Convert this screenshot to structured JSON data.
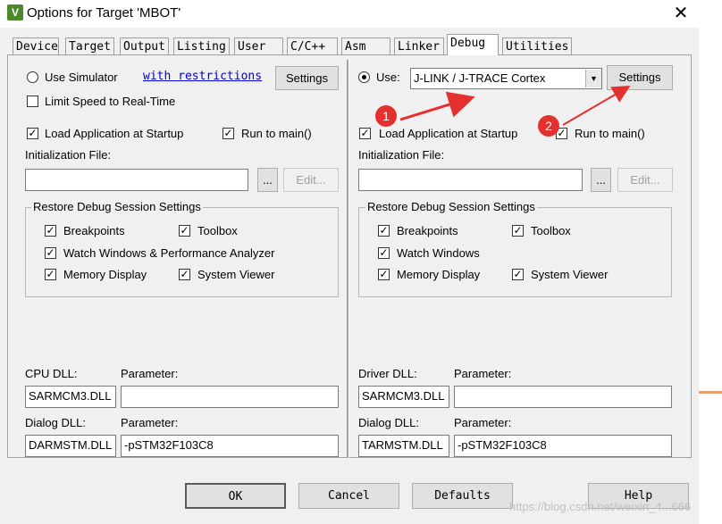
{
  "window": {
    "title": "Options for Target 'MBOT'",
    "app_icon_text": "V"
  },
  "tabs": [
    "Device",
    "Target",
    "Output",
    "Listing",
    "User",
    "C/C++",
    "Asm",
    "Linker",
    "Debug",
    "Utilities"
  ],
  "active_tab": "Debug",
  "left": {
    "use_simulator_label": "Use Simulator",
    "restrictions_link": "with restrictions",
    "settings_label": "Settings",
    "limit_speed_label": "Limit Speed to Real-Time",
    "load_app_label": "Load Application at Startup",
    "run_to_main_label": "Run to main()",
    "init_file_label": "Initialization File:",
    "browse_label": "...",
    "edit_label": "Edit...",
    "restore_group_label": "Restore Debug Session Settings",
    "breakpoints_label": "Breakpoints",
    "toolbox_label": "Toolbox",
    "watch_label": "Watch Windows & Performance Analyzer",
    "memory_label": "Memory Display",
    "sysviewer_label": "System Viewer",
    "cpu_dll_label": "CPU DLL:",
    "param_label": "Parameter:",
    "cpu_dll_value": "SARMCM3.DLL",
    "cpu_param_value": "",
    "dialog_dll_label": "Dialog DLL:",
    "dialog_dll_value": "DARMSTM.DLL",
    "dialog_param_value": "-pSTM32F103C8"
  },
  "right": {
    "use_label": "Use:",
    "debugger_value": "J-LINK / J-TRACE Cortex",
    "settings_label": "Settings",
    "load_app_label": "Load Application at Startup",
    "run_to_main_label": "Run to main()",
    "init_file_label": "Initialization File:",
    "browse_label": "...",
    "edit_label": "Edit...",
    "restore_group_label": "Restore Debug Session Settings",
    "breakpoints_label": "Breakpoints",
    "toolbox_label": "Toolbox",
    "watch_label": "Watch Windows",
    "memory_label": "Memory Display",
    "sysviewer_label": "System Viewer",
    "driver_dll_label": "Driver DLL:",
    "param_label": "Parameter:",
    "driver_dll_value": "SARMCM3.DLL",
    "driver_param_value": "",
    "dialog_dll_label": "Dialog DLL:",
    "dialog_dll_value": "TARMSTM.DLL",
    "dialog_param_value": "-pSTM32F103C8"
  },
  "annotations": {
    "badge1": "1",
    "badge2": "2",
    "color": "#e53030"
  },
  "footer": {
    "ok": "OK",
    "cancel": "Cancel",
    "defaults": "Defaults",
    "help": "Help"
  },
  "watermark": "https://blog.csdn.net/weixin_4...666"
}
